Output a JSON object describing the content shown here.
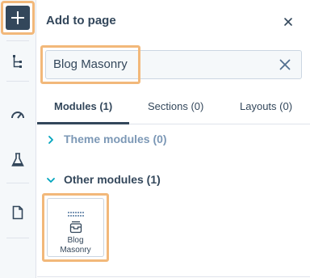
{
  "panel": {
    "title": "Add to page",
    "close_icon": "close-icon"
  },
  "rail": {
    "add_icon": "plus-icon",
    "items": [
      {
        "icon": "tree-structure-icon"
      },
      {
        "icon": "gauge-icon"
      },
      {
        "icon": "flask-icon"
      },
      {
        "icon": "page-icon"
      }
    ]
  },
  "search": {
    "value": "Blog Masonry",
    "clear_icon": "clear-icon"
  },
  "tabs": [
    {
      "label": "Modules (1)",
      "active": true
    },
    {
      "label": "Sections (0)",
      "active": false
    },
    {
      "label": "Layouts (0)",
      "active": false
    }
  ],
  "groups": {
    "theme": {
      "label": "Theme modules (0)",
      "expanded": false
    },
    "other": {
      "label": "Other modules (1)",
      "expanded": true
    }
  },
  "module": {
    "label_line1": "Blog",
    "label_line2": "Masonry"
  },
  "colors": {
    "highlight": "#f2b87a",
    "text": "#33475b",
    "accent_dark": "#33475b"
  }
}
